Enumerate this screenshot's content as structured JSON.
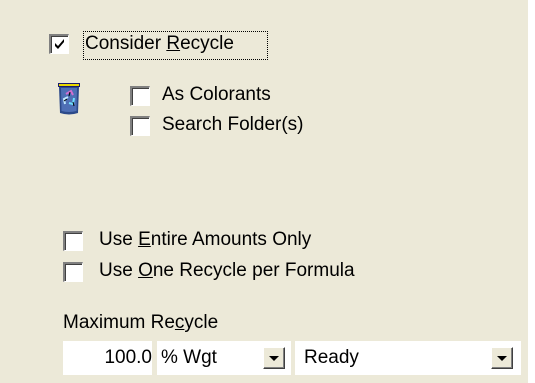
{
  "consider_recycle": {
    "checked": true,
    "label_pre": "Consider ",
    "label_accel": "R",
    "label_post": "ecycle"
  },
  "as_colorants": {
    "checked": false,
    "label": "As Colorants"
  },
  "search_folders": {
    "checked": false,
    "label": "Search Folder(s)"
  },
  "use_entire_amounts": {
    "checked": false,
    "label_pre": "Use ",
    "label_accel": "E",
    "label_post": "ntire Amounts Only"
  },
  "use_one_recycle": {
    "checked": false,
    "label_pre": "Use ",
    "label_accel": "O",
    "label_post": "ne Recycle per Formula"
  },
  "maximum_recycle": {
    "label_pre": "Maximum Re",
    "label_accel": "c",
    "label_post": "ycle",
    "value": "100.0",
    "unit": "% Wgt",
    "status": "Ready"
  },
  "icons": {
    "recycle": "recycle-bin-icon"
  }
}
